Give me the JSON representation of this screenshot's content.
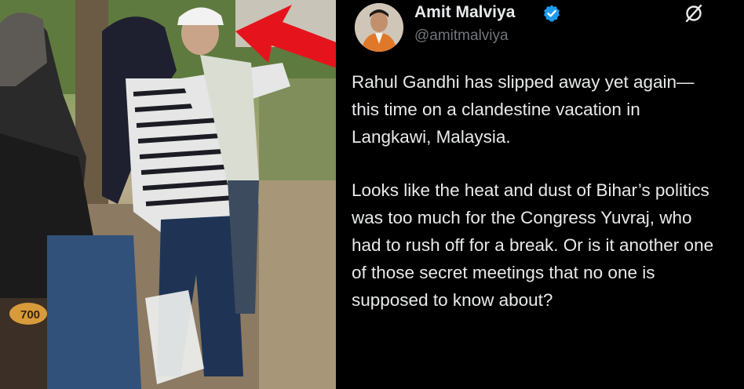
{
  "tweet": {
    "author_name": "Amit Malviya",
    "handle": "@amitmalviya",
    "verified": true,
    "verified_color": "#1d9bf0",
    "logo_icon": "x-logo-icon",
    "paragraphs": [
      "Rahul Gandhi has slipped away yet again—this time on a clandestine vacation in Langkawi, Malaysia.",
      "Looks like the heat and dust of Bihar’s politics was too much for the Congress Yuvraj, who had to rush off for a break. Or is it another one of those secret meetings that no one is supposed to know about?"
    ]
  },
  "photo": {
    "annotation": "red-arrow",
    "arrow_color": "#e5141c",
    "sign_text": "700"
  }
}
